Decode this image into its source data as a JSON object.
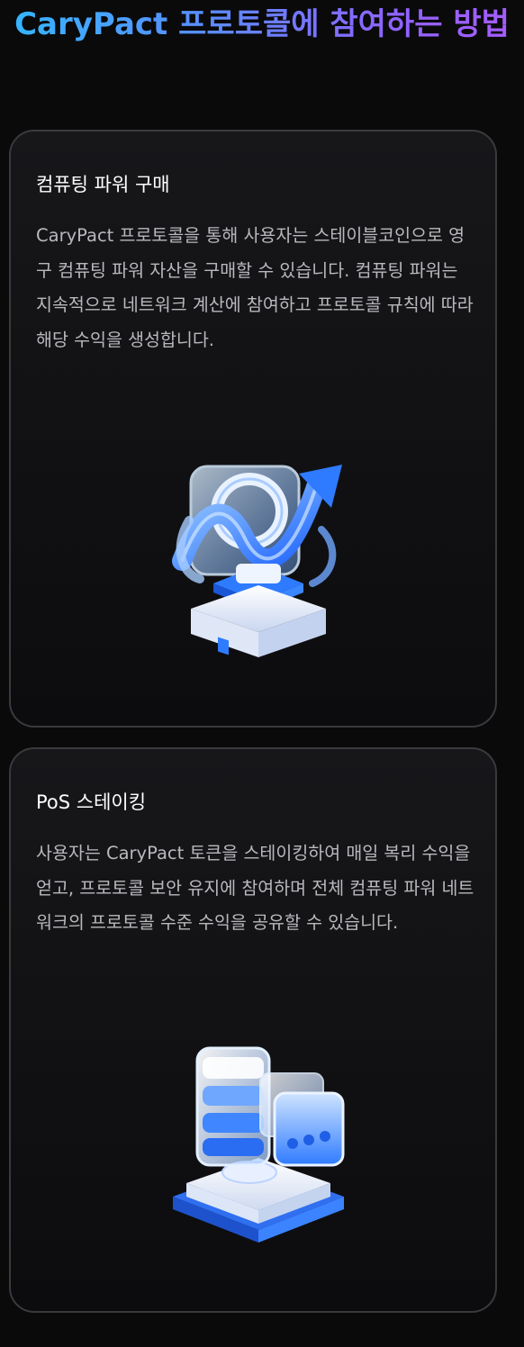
{
  "page": {
    "title": "CaryPact 프로토콜에 참여하는 방법"
  },
  "cards": [
    {
      "title": "컴퓨팅 파워 구매",
      "description": "CaryPact 프로토콜을 통해 사용자는 스테이블코인으로 영구 컴퓨팅 파워 자산을 구매할 수 있습니다. 컴퓨팅 파워는 지속적으로 네트워크 계산에 참여하고 프로토콜 규칙에 따라 해당 수익을 생성합니다.",
      "icon": "computing-power-chart-icon"
    },
    {
      "title": "PoS 스테이킹",
      "description": "사용자는 CaryPact 토큰을 스테이킹하여 매일 복리 수익을 얻고, 프로토콜 보안 유지에 참여하며 전체 컴퓨팅 파워 네트워크의 프로토콜 수준 수익을 공유할 수 있습니다.",
      "icon": "staking-database-icon"
    }
  ],
  "colors": {
    "background": "#0a0a0b",
    "card_border": "#3a3a3e",
    "title_gradient_start": "#33b8ff",
    "title_gradient_end": "#a85cff",
    "icon_blue": "#2f7bff"
  }
}
